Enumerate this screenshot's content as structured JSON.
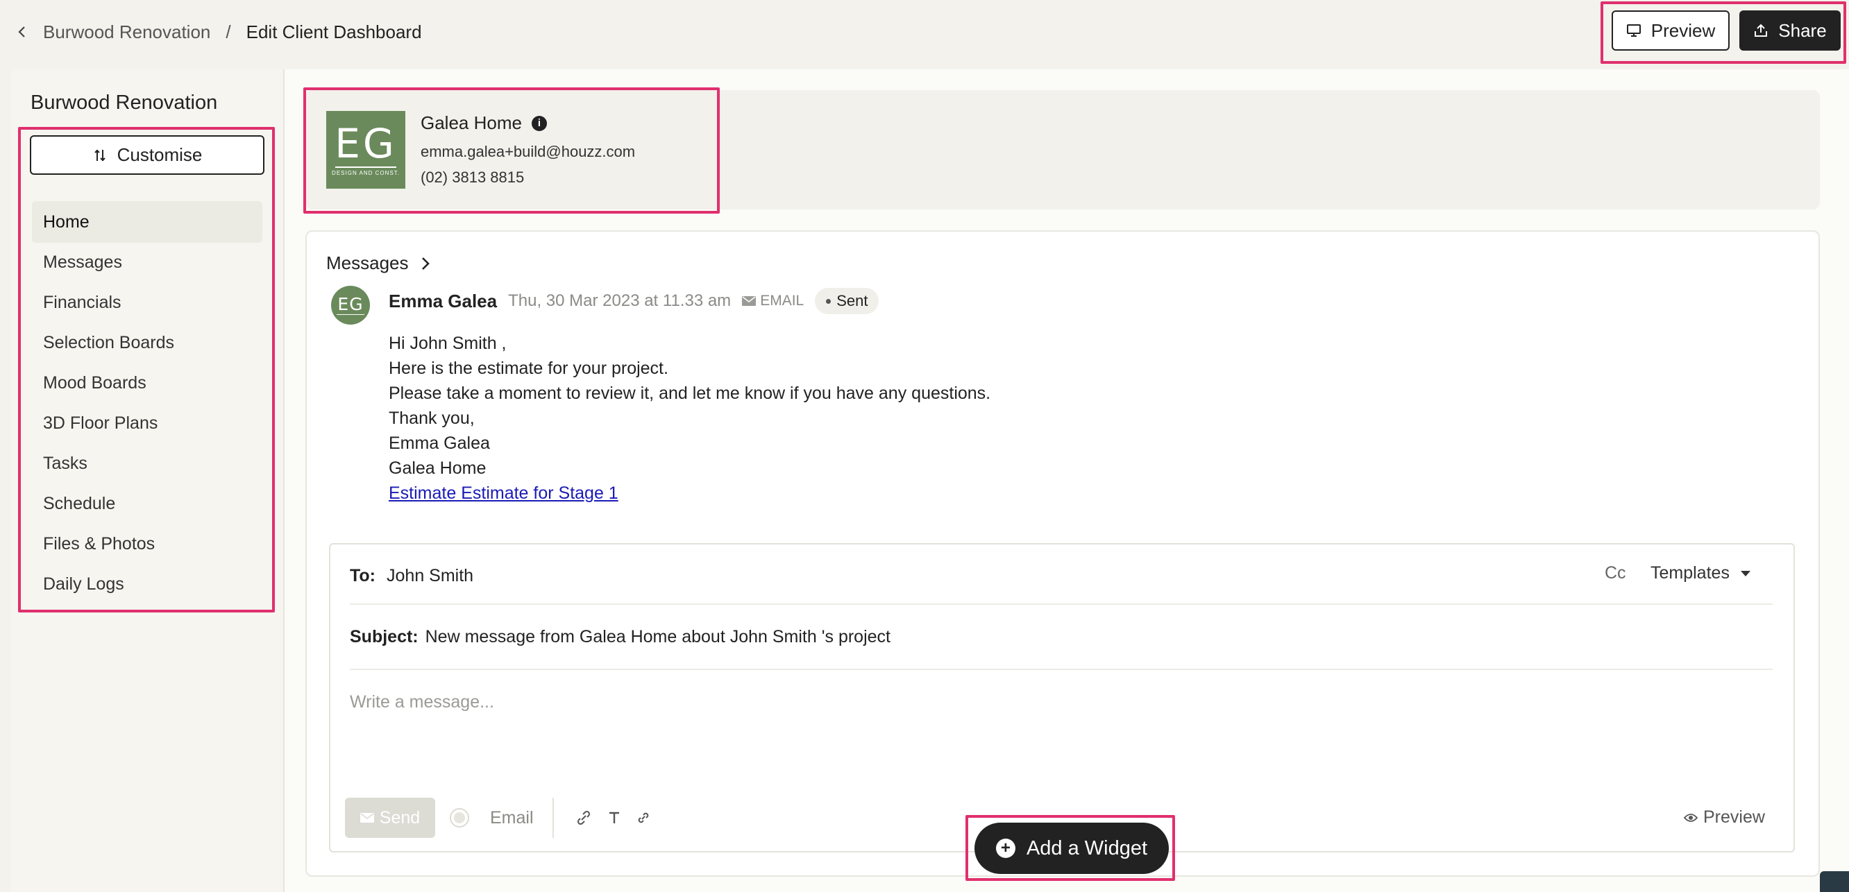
{
  "breadcrumb": {
    "parent": "Burwood Renovation",
    "separator": "/",
    "current": "Edit Client Dashboard"
  },
  "header_actions": {
    "preview_label": "Preview",
    "share_label": "Share"
  },
  "sidebar": {
    "title": "Burwood Renovation",
    "customise_label": "Customise",
    "items": [
      {
        "label": "Home",
        "active": true
      },
      {
        "label": "Messages"
      },
      {
        "label": "Financials"
      },
      {
        "label": "Selection Boards"
      },
      {
        "label": "Mood Boards"
      },
      {
        "label": "3D Floor Plans"
      },
      {
        "label": "Tasks"
      },
      {
        "label": "Schedule"
      },
      {
        "label": "Files & Photos"
      },
      {
        "label": "Daily Logs"
      }
    ]
  },
  "company": {
    "logo_text": "EG",
    "logo_subtext": "DESIGN AND CONST.",
    "name": "Galea Home",
    "email": "emma.galea+build@houzz.com",
    "phone": "(02) 3813 8815"
  },
  "messages": {
    "heading": "Messages",
    "sender": "Emma Galea",
    "avatar_text": "EG",
    "timestamp": "Thu, 30 Mar 2023 at 11.33 am",
    "channel": "EMAIL",
    "status": "Sent",
    "body_lines": [
      "Hi John Smith ,",
      "Here is the estimate for your project.",
      "Please take a moment to review it, and let me know if you have any questions.",
      "Thank you,",
      "Emma Galea",
      "Galea Home"
    ],
    "link_text": "Estimate Estimate for Stage 1"
  },
  "composer": {
    "to_label": "To:",
    "to_value": "John Smith",
    "cc_label": "Cc",
    "templates_label": "Templates",
    "subject_label": "Subject:",
    "subject_value": "New message from Galea Home about John Smith 's project",
    "message_placeholder": "Write a message...",
    "send_label": "Send",
    "email_option_label": "Email",
    "preview_label": "Preview"
  },
  "add_widget_label": "Add a Widget",
  "colors": {
    "highlight": "#e0306e",
    "brand_green": "#6a8a5b",
    "link": "#1a1ab8"
  }
}
